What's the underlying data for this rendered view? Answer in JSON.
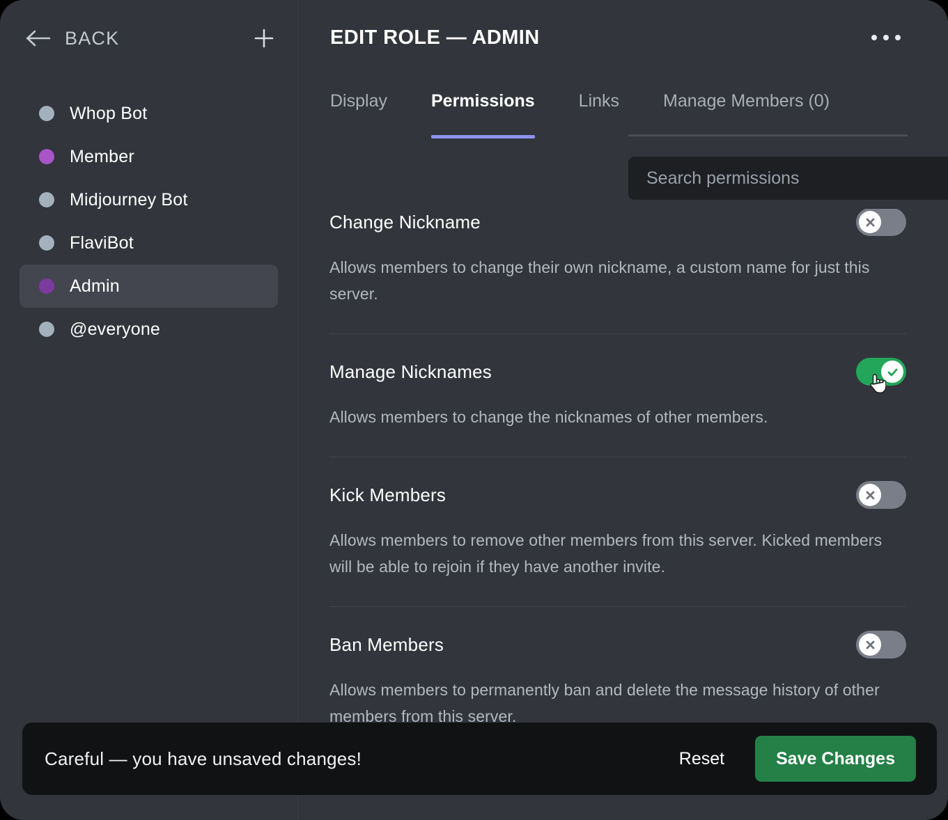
{
  "sidebar": {
    "back_label": "BACK",
    "back_icon": "arrow-left-icon",
    "add_icon": "plus-icon",
    "roles": [
      {
        "name": "Whop Bot",
        "color": "#a3b1bd",
        "selected": false
      },
      {
        "name": "Member",
        "color": "#a855c8",
        "selected": false
      },
      {
        "name": "Midjourney Bot",
        "color": "#a3b1bd",
        "selected": false
      },
      {
        "name": "FlaviBot",
        "color": "#a3b1bd",
        "selected": false
      },
      {
        "name": "Admin",
        "color": "#7b3a9e",
        "selected": true
      },
      {
        "name": "@everyone",
        "color": "#a3b1bd",
        "selected": false
      }
    ]
  },
  "main": {
    "title": "EDIT ROLE — ADMIN",
    "overflow_icon": "kebab-menu-icon",
    "tabs": [
      {
        "label": "Display",
        "active": false
      },
      {
        "label": "Permissions",
        "active": true
      },
      {
        "label": "Links",
        "active": false
      },
      {
        "label": "Manage Members (0)",
        "active": false
      }
    ],
    "active_tab_color": "#8b92f0"
  },
  "search": {
    "placeholder": "Search permissions",
    "value": "",
    "icon": "search-icon"
  },
  "permissions": [
    {
      "name": "Change Nickname",
      "description": "Allows members to change their own nickname, a custom name for just this server.",
      "enabled": false
    },
    {
      "name": "Manage Nicknames",
      "description": "Allows members to change the nicknames of other members.",
      "enabled": true
    },
    {
      "name": "Kick Members",
      "description": "Allows members to remove other members from this server. Kicked members will be able to rejoin if they have another invite.",
      "enabled": false
    },
    {
      "name": "Ban Members",
      "description": "Allows members to permanently ban and delete the message history of other members from this server.",
      "enabled": false
    }
  ],
  "save_bar": {
    "message": "Careful — you have unsaved changes!",
    "reset_label": "Reset",
    "save_label": "Save Changes",
    "save_color": "#248046"
  },
  "colors": {
    "toggle_on": "#23a55a",
    "toggle_off": "#797e88",
    "panel_bg": "#32353b",
    "selected_row": "#43464f"
  }
}
